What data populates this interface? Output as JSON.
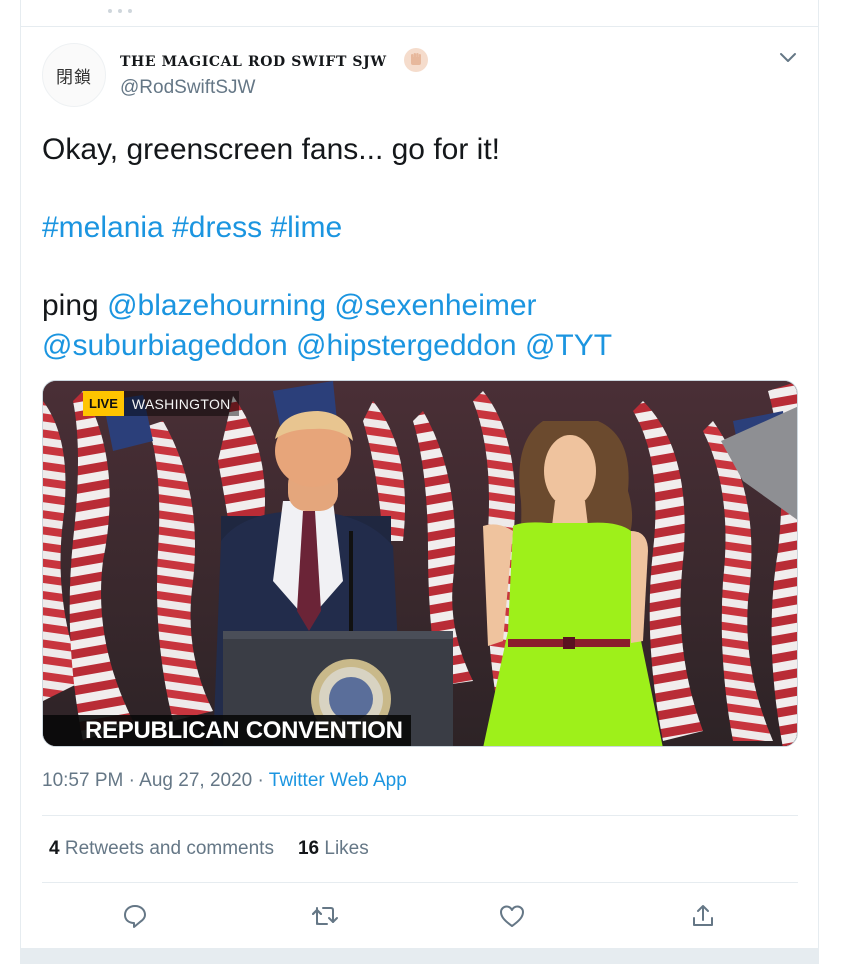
{
  "tweet": {
    "avatar_text": "閉鎖",
    "display_name": "THE MAGICAL ROD SWIFT SJW",
    "handle": "@RodSwiftSJW",
    "text_line1": "Okay, greenscreen fans... go for it!",
    "hashtags": [
      "#melania",
      "#dress",
      "#lime"
    ],
    "ping_prefix": "ping",
    "mentions": [
      "@blazehourning",
      "@sexenheimer",
      "@suburbiageddon",
      "@hipstergeddon",
      "@TYT"
    ],
    "media": {
      "live_label": "LIVE",
      "location": "WASHINGTON",
      "chyron": "REPUBLICAN CONVENTION"
    },
    "time": "10:57 PM",
    "separator": "·",
    "date": "Aug 27, 2020",
    "source": "Twitter Web App",
    "retweets_count": "4",
    "retweets_label": "Retweets and comments",
    "likes_count": "16",
    "likes_label": "Likes"
  },
  "icons": {
    "reply": "reply-icon",
    "retweet": "retweet-icon",
    "like": "like-icon",
    "share": "share-icon",
    "caret": "chevron-down-icon"
  },
  "colors": {
    "link": "#1b95e0",
    "secondary_text": "#657786",
    "border": "#e6ecf0",
    "dress_green": "#9ef01a",
    "live_yellow": "#ffc400"
  }
}
